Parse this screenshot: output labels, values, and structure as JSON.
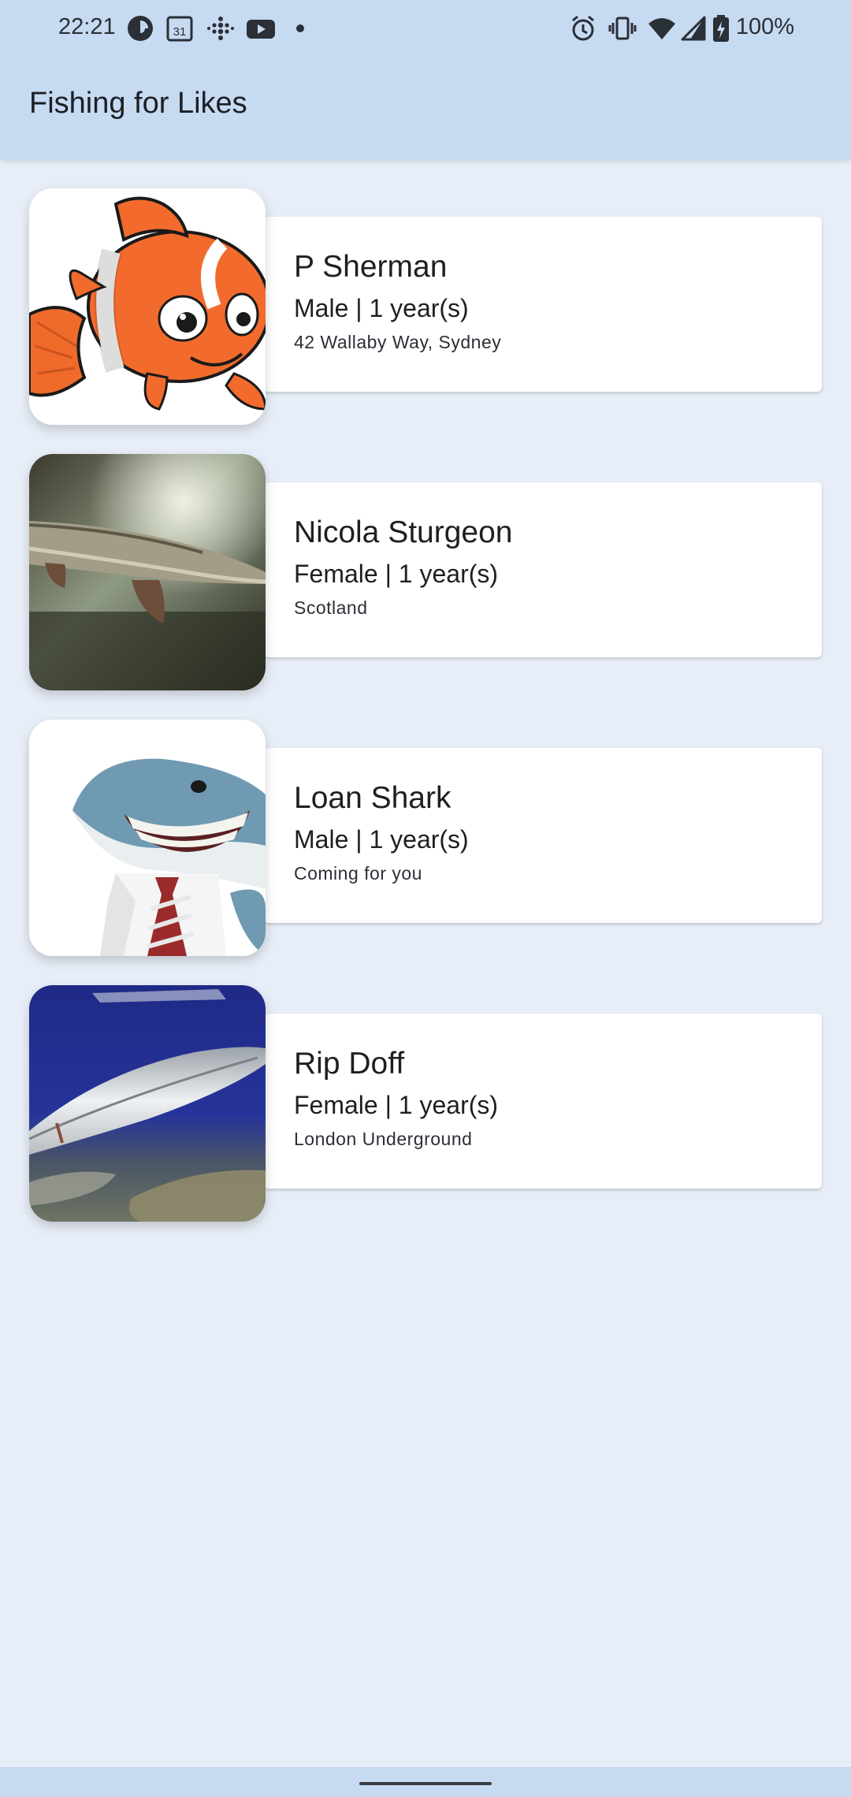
{
  "status_bar": {
    "time": "22:21",
    "left_icons": [
      "pocket-casts-icon",
      "calendar-31-icon",
      "fitbit-icon",
      "youtube-icon",
      "dot-icon"
    ],
    "calendar_day": "31",
    "right_icons": [
      "alarm-icon",
      "vibrate-icon",
      "wifi-icon",
      "signal-icon",
      "battery-charging-icon"
    ],
    "battery": "100%"
  },
  "app_bar": {
    "title": "Fishing for Likes"
  },
  "profiles": [
    {
      "name": "P Sherman",
      "details": "Male | 1 year(s)",
      "location": "42 Wallaby Way, Sydney",
      "image": "clownfish"
    },
    {
      "name": "Nicola Sturgeon",
      "details": "Female | 1 year(s)",
      "location": "Scotland",
      "image": "sturgeon"
    },
    {
      "name": "Loan Shark",
      "details": "Male | 1 year(s)",
      "location": "Coming for you",
      "image": "shark-in-tie"
    },
    {
      "name": "Rip Doff",
      "details": "Female | 1 year(s)",
      "location": "London Underground",
      "image": "silver-fish"
    }
  ],
  "colors": {
    "app_bar": "#c6daf2",
    "background": "#e8eef8",
    "card": "#ffffff"
  }
}
